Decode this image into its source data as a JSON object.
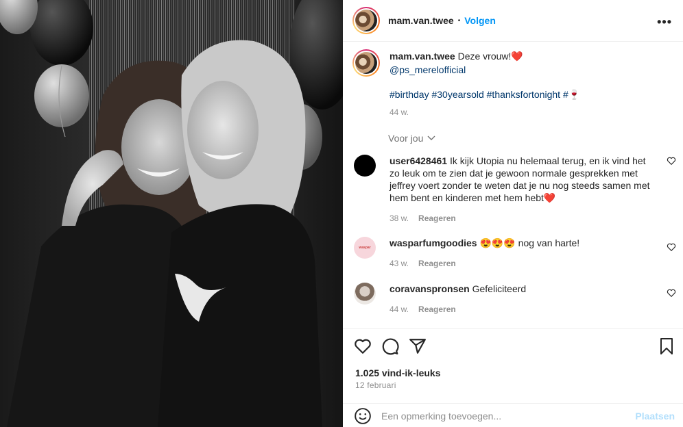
{
  "post": {
    "username": "mam.van.twee",
    "follow_label": "Volgen",
    "more_icon": "more-horizontal-icon"
  },
  "caption": {
    "username": "mam.van.twee",
    "text": "Deze vrouw!❤️",
    "mention": "@ps_merelofficial",
    "hashtags": "#birthday #30yearsold #thanksfortonight #🍷",
    "time": "44 w."
  },
  "sort": {
    "label": "Voor jou"
  },
  "comments": [
    {
      "username": "user6428461",
      "text": "Ik kijk Utopia nu helemaal terug, en ik vind het zo leuk om te zien dat je gewoon normale gesprekken met jeffrey voert zonder te weten dat je nu nog steeds samen met hem bent en kinderen met hem hebt❤️",
      "time": "38 w.",
      "reply": "Reageren"
    },
    {
      "username": "wasparfumgoodies",
      "text": "😍😍😍 nog van harte!",
      "time": "43 w.",
      "reply": "Reageren"
    },
    {
      "username": "coravanspronsen",
      "text": "Gefeliciteerd",
      "time": "44 w.",
      "reply": "Reageren"
    }
  ],
  "engagement": {
    "likes": "1.025 vind-ik-leuks",
    "date": "12 februari"
  },
  "add_comment": {
    "placeholder": "Een opmerking toevoegen...",
    "post_label": "Plaatsen"
  },
  "colors": {
    "accent": "#0095f6",
    "link": "#00376b",
    "muted": "#8e8e8e"
  }
}
